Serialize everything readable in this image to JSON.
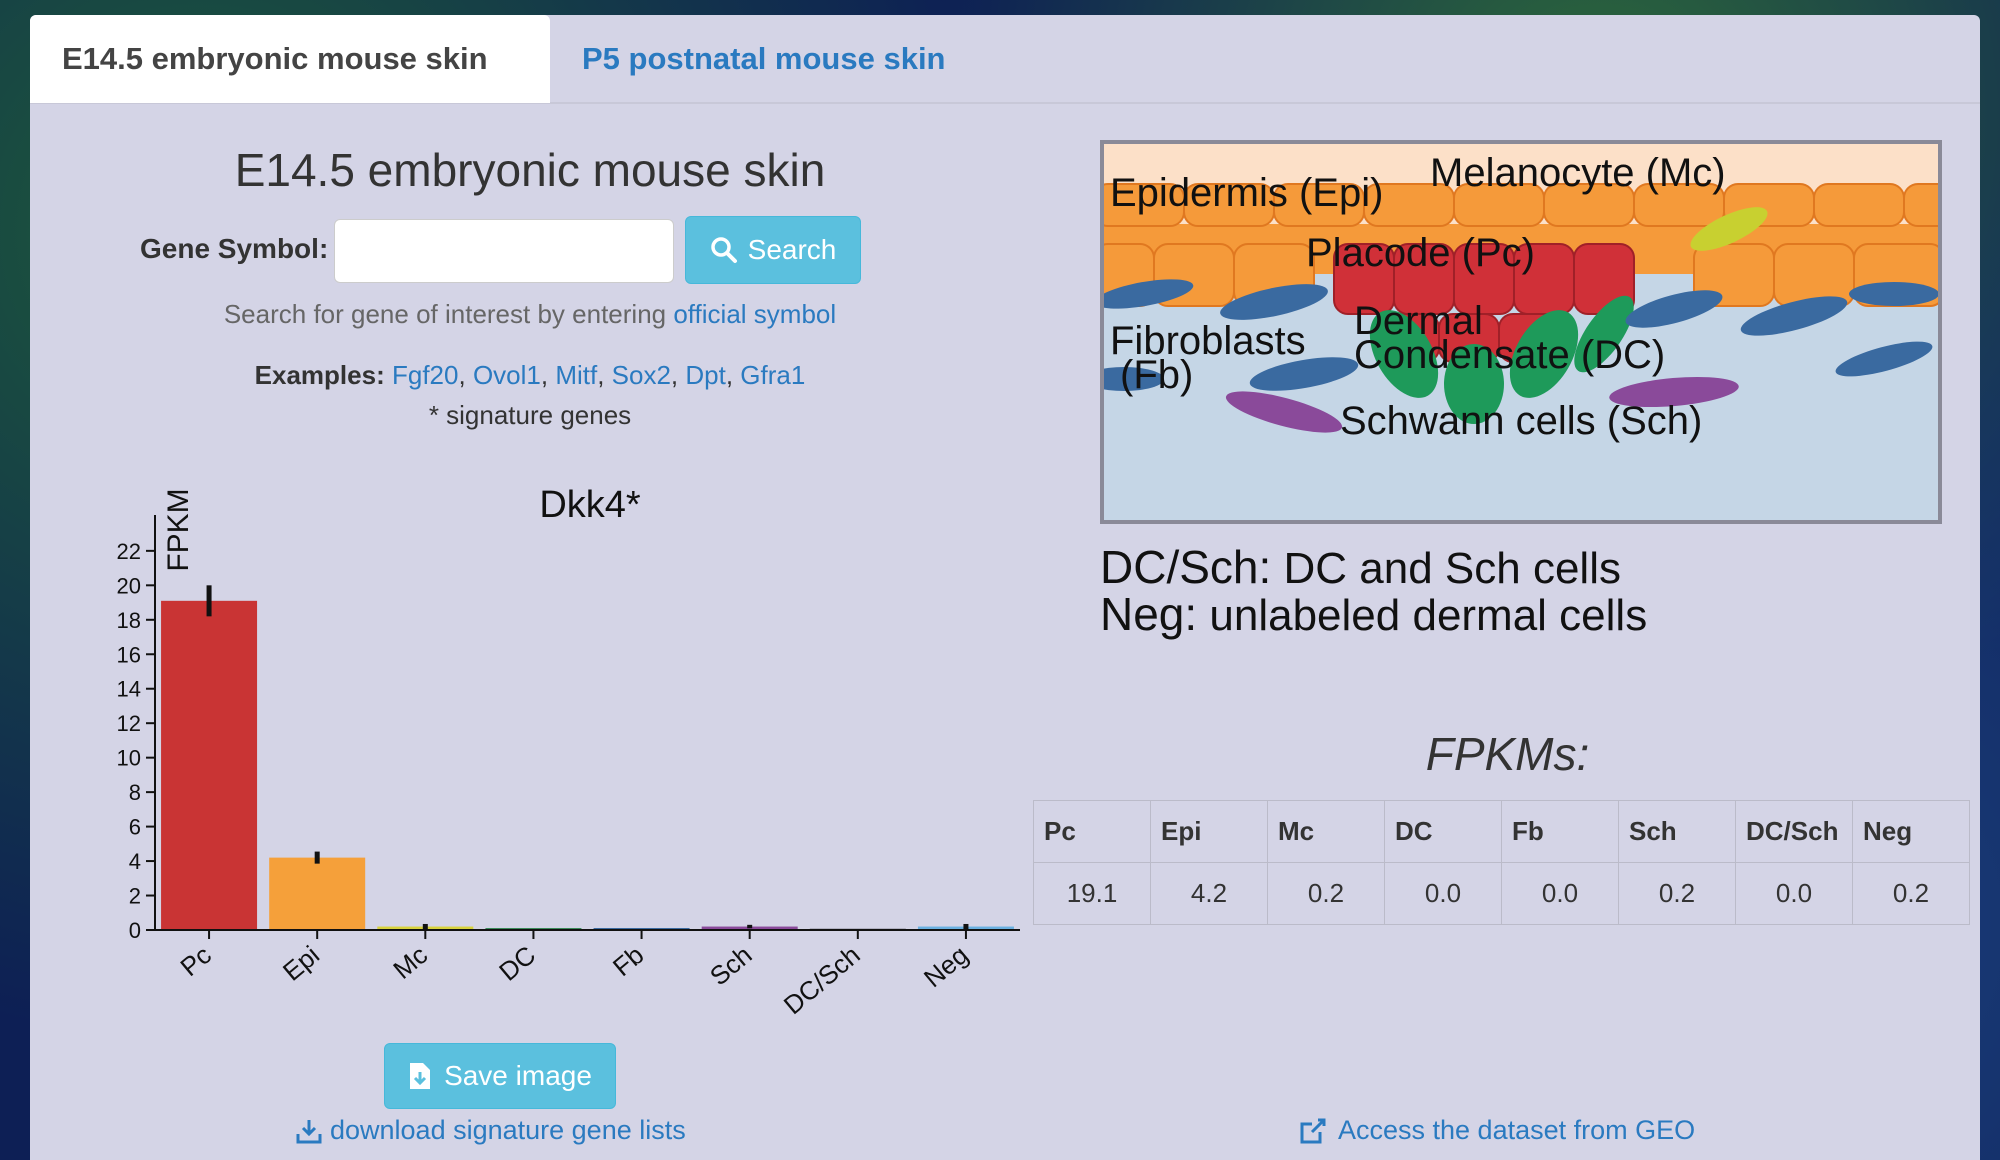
{
  "tabs": [
    {
      "label": "E14.5 embryonic mouse skin",
      "active": true
    },
    {
      "label": "P5 postnatal mouse skin",
      "active": false
    }
  ],
  "main": {
    "title": "E14.5 embryonic mouse skin",
    "gene_label": "Gene Symbol:",
    "search_value": "",
    "search_button": "Search",
    "hint_prefix": "Search for gene of interest by entering ",
    "hint_link": "official symbol",
    "examples_label": "Examples:",
    "examples": [
      "Fgf20",
      "Ovol1",
      "Mitf",
      "Sox2",
      "Dpt",
      "Gfra1"
    ],
    "signature_note": "* signature genes",
    "save_button": "Save image",
    "download_link": "download signature gene lists"
  },
  "chart_data": {
    "type": "bar",
    "title": "Dkk4*",
    "ylabel": "FPKM",
    "xlabel": "",
    "ylim": [
      0,
      23.5
    ],
    "yticks": [
      0,
      2,
      4,
      6,
      8,
      10,
      12,
      14,
      16,
      18,
      20,
      22
    ],
    "categories": [
      "Pc",
      "Epi",
      "Mc",
      "DC",
      "Fb",
      "Sch",
      "DC/Sch",
      "Neg"
    ],
    "values": [
      19.1,
      4.2,
      0.2,
      0.0,
      0.0,
      0.2,
      0.0,
      0.2
    ],
    "errors": [
      0.9,
      0.35,
      0.15,
      0.0,
      0.0,
      0.1,
      0.0,
      0.15
    ],
    "colors": [
      "#c93434",
      "#f5a03a",
      "#d8d23c",
      "#3a8a5a",
      "#3a6aa0",
      "#8a4a9a",
      "#b0b0c0",
      "#6ab0e0"
    ],
    "grid": false,
    "legend": "none"
  },
  "diagram": {
    "labels": {
      "epi": "Epidermis (Epi)",
      "mc": "Melanocyte (Mc)",
      "pc": "Placode (Pc)",
      "fb1": "Fibroblasts",
      "fb2": "(Fb)",
      "dc1": "Dermal",
      "dc2": "Condensate (DC)",
      "sch": "Schwann cells (Sch)"
    },
    "legend": [
      {
        "key": "DC/Sch:",
        "text": " DC and Sch cells"
      },
      {
        "key": "Neg:",
        "text": " unlabeled dermal cells"
      }
    ]
  },
  "fpkm_table": {
    "title": "FPKMs:",
    "headers": [
      "Pc",
      "Epi",
      "Mc",
      "DC",
      "Fb",
      "Sch",
      "DC/Sch",
      "Neg"
    ],
    "values": [
      "19.1",
      "4.2",
      "0.2",
      "0.0",
      "0.0",
      "0.2",
      "0.0",
      "0.2"
    ]
  },
  "geo_link": "Access the dataset from GEO",
  "colors": {
    "accent_link": "#2a7ac0",
    "button": "#5bc0de",
    "panel": "#d4d4e6"
  }
}
